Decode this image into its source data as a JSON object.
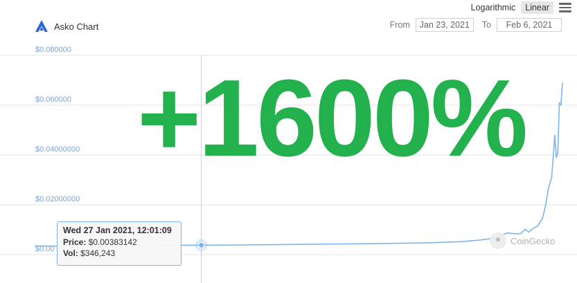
{
  "toolbar": {
    "logarithmic_label": "Logarithmic",
    "linear_label": "Linear",
    "active_scale": "Linear"
  },
  "header": {
    "title": "Asko Chart",
    "from_label": "From",
    "from_value": "Jan 23, 2021",
    "to_label": "To",
    "to_value": "Feb 6, 2021"
  },
  "overlay": {
    "headline": "+1600%",
    "color": "#22b14c"
  },
  "tooltip": {
    "date": "Wed 27 Jan 2021, 12:01:09",
    "price_label": "Price:",
    "price_value": "$0.00383142",
    "vol_label": "Vol:",
    "vol_value": "$346,243"
  },
  "credit": {
    "text": "CoinGecko"
  },
  "colors": {
    "line": "#7cb5ec",
    "grid": "#e6e6e6",
    "tick_label": "#7aa3d6",
    "logo": "#2a6ad8"
  },
  "chart_data": {
    "type": "line",
    "title": "",
    "xlabel": "",
    "ylabel": "",
    "ylim": [
      0,
      0.08
    ],
    "grid": true,
    "legend": "none",
    "y_ticks": [
      {
        "value": 0,
        "label": "$0.00"
      },
      {
        "value": 0.02,
        "label": "$0.02000000"
      },
      {
        "value": 0.04,
        "label": "$0.04000000"
      },
      {
        "value": 0.06,
        "label": "$0.060000"
      },
      {
        "value": 0.08,
        "label": "$0.080000"
      }
    ],
    "xlim": [
      "2021-01-23",
      "2021-02-06"
    ],
    "series": [
      {
        "x": [
          "2021-01-23 00:00",
          "2021-01-24 00:00",
          "2021-01-25 00:00",
          "2021-01-26 12:00",
          "2021-01-27 12:01",
          "2021-01-28 12:00",
          "2021-01-29 12:00",
          "2021-01-30 12:00",
          "2021-01-31 12:00",
          "2021-02-01 12:00",
          "2021-02-02 12:00",
          "2021-02-03 12:00",
          "2021-02-04 00:00",
          "2021-02-04 12:00",
          "2021-02-04 18:00",
          "2021-02-05 00:00",
          "2021-02-05 03:00",
          "2021-02-05 06:00",
          "2021-02-05 08:00",
          "2021-02-05 11:00",
          "2021-02-05 14:00",
          "2021-02-05 17:00",
          "2021-02-05 19:00",
          "2021-02-05 21:00",
          "2021-02-05 23:00",
          "2021-02-06 00:00",
          "2021-02-06 01:00",
          "2021-02-06 02:00",
          "2021-02-06 03:00",
          "2021-02-06 04:00",
          "2021-02-06 05:00",
          "2021-02-06 06:00"
        ],
        "y": [
          0.0035,
          0.0034,
          0.0035,
          0.0037,
          0.0038,
          0.0039,
          0.004,
          0.0042,
          0.0043,
          0.0045,
          0.0047,
          0.0052,
          0.0058,
          0.0068,
          0.0087,
          0.0083,
          0.0085,
          0.0102,
          0.009,
          0.0105,
          0.0115,
          0.0145,
          0.0195,
          0.0268,
          0.031,
          0.039,
          0.048,
          0.039,
          0.041,
          0.061,
          0.06,
          0.069
        ]
      }
    ]
  }
}
